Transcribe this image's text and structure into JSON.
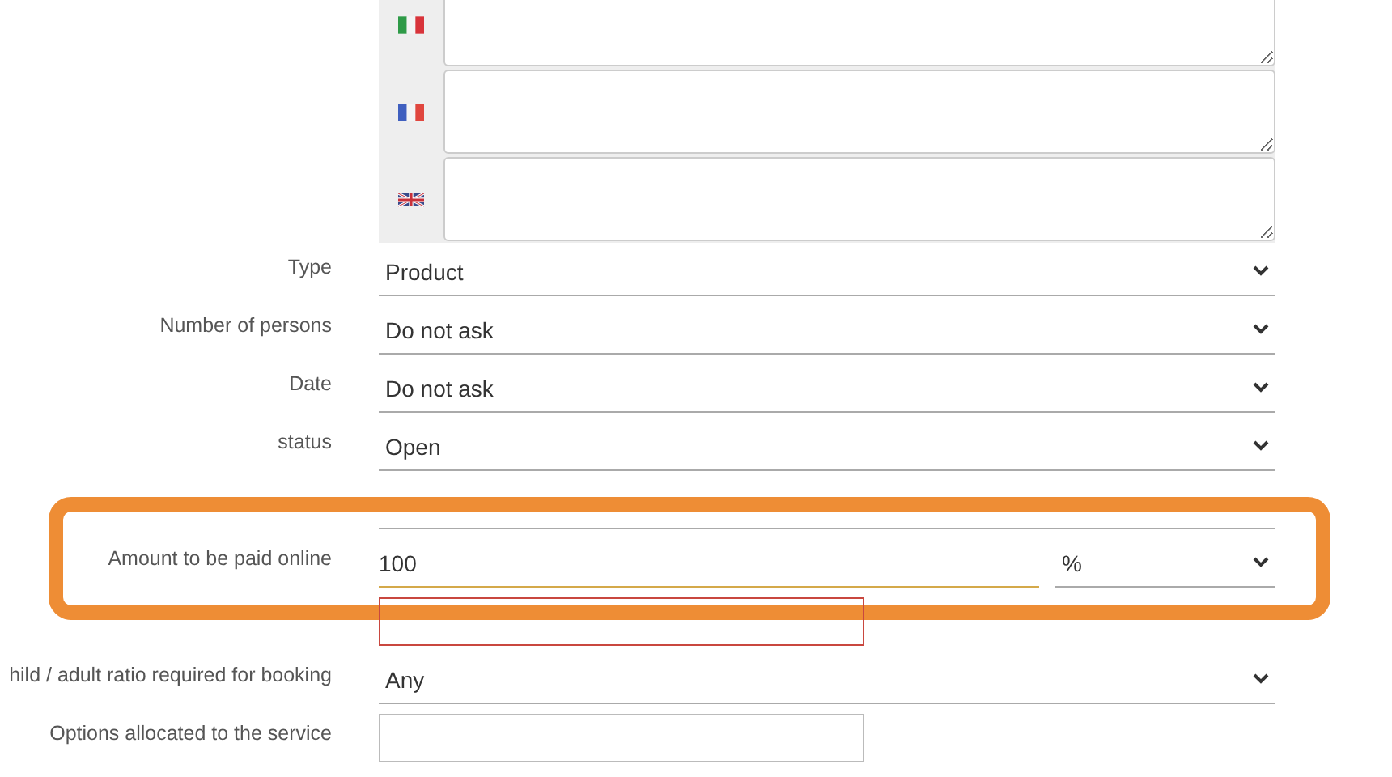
{
  "translations": [
    {
      "kind": "italy"
    },
    {
      "kind": "france"
    },
    {
      "kind": "uk"
    }
  ],
  "rows": [
    {
      "kind": "select",
      "label": "Type",
      "value": "Product"
    },
    {
      "kind": "select",
      "label": "Number of persons",
      "value": "Do not ask"
    },
    {
      "kind": "select",
      "label": "Date",
      "value": "Do not ask"
    },
    {
      "kind": "select",
      "label": "status",
      "value": "Open"
    },
    {
      "kind": "line"
    },
    {
      "kind": "amount",
      "label": "Amount to be paid online",
      "value": "100",
      "unit": "%",
      "highlighted": true
    },
    {
      "kind": "box",
      "invalid": true
    },
    {
      "kind": "select",
      "label": "hild / adult ratio required for booking",
      "value": "Any"
    },
    {
      "kind": "box",
      "label": "Options allocated to the service",
      "invalid": false
    }
  ]
}
